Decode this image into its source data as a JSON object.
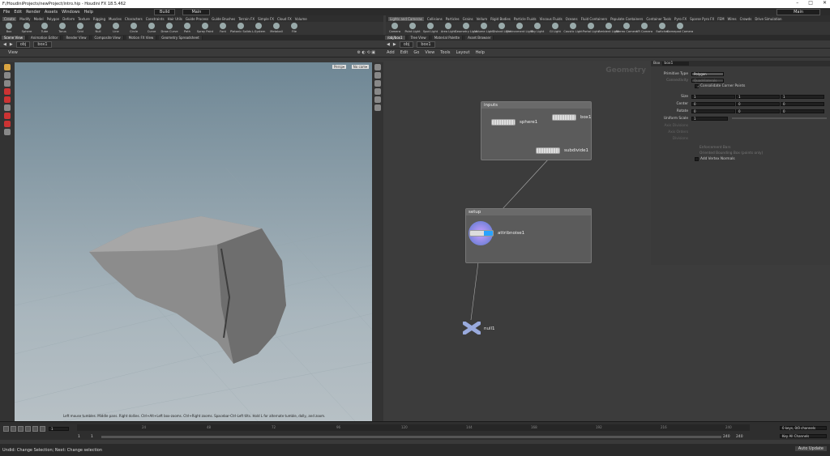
{
  "window": {
    "title": "F:/HoudiniProjects/newProject/intro.hip - Houdini FX 18.5.462",
    "controls": [
      "–",
      "□",
      "✕"
    ]
  },
  "menubar": {
    "items": [
      "File",
      "Edit",
      "Render",
      "Assets",
      "Windows",
      "Help"
    ],
    "desktop": "Build",
    "desktop2": "Main",
    "right_desktop": "Main"
  },
  "shelf_left": {
    "tabs": [
      "Create",
      "Modify",
      "Model",
      "Polygon",
      "Deform",
      "Texture",
      "Rigging",
      "Muscles",
      "Characters",
      "Constraints",
      "Hair Utils",
      "Guide Process",
      "Guide Brushes",
      "Terrain FX",
      "Simple FX",
      "Cloud FX",
      "Volume"
    ],
    "active_tab": "Create",
    "tools": [
      "Box",
      "Sphere",
      "Tube",
      "Torus",
      "Grid",
      "Null",
      "Line",
      "Circle",
      "Curve",
      "Draw Curve",
      "Path",
      "Spray Paint",
      "Font",
      "Platonic Solids",
      "L-System",
      "Metaball",
      "File"
    ]
  },
  "shelf_right": {
    "tabs": [
      "Lights and Cameras",
      "Collisions",
      "Particles",
      "Grains",
      "Vellum",
      "Rigid Bodies",
      "Particle Fluids",
      "Viscous Fluids",
      "Oceans",
      "Fluid Containers",
      "Populate Containers",
      "Container Tools",
      "Pyro FX",
      "Sparse Pyro FX",
      "FEM",
      "Wires",
      "Crowds",
      "Drive Simulation"
    ],
    "active_tab": "Lights and Cameras",
    "tools": [
      "Camera",
      "Point Light",
      "Spot Light",
      "Area Light",
      "Geometry Light",
      "Volume Light",
      "Distant Light",
      "Environment Light",
      "Sky Light",
      "GI Light",
      "Caustic Light",
      "Portal Light",
      "Ambient Light",
      "Stereo Camera",
      "VR Camera",
      "Switcher",
      "Gamepad Camera"
    ]
  },
  "left_panel": {
    "tabs": [
      "Scene View",
      "Animation Editor",
      "Render View",
      "Composite View",
      "Motion FX View",
      "Geometry Spreadsheet"
    ],
    "active_tab": "Scene View",
    "path": [
      "obj",
      "box1"
    ],
    "view_label": "View",
    "persp": "Persp▾",
    "nocam": "No cam▾",
    "hint": "Left mouse tumbles. Middle pans. Right dollies. Ctrl+Alt+Left box-zooms. Ctrl+Right zooms. Spacebar-Ctrl-Left tilts. Hold L for alternate tumble, dolly, and zoom."
  },
  "right_panel": {
    "tabs": [
      "/obj/box1",
      "Tree View",
      "Material Palette",
      "Asset Browser"
    ],
    "active_tab": "/obj/box1",
    "path": [
      "obj",
      "box1"
    ],
    "menu": [
      "Add",
      "Edit",
      "Go",
      "View",
      "Tools",
      "Layout",
      "Help"
    ],
    "context_label": "Geometry"
  },
  "network": {
    "boxes": [
      {
        "title": "inputs"
      },
      {
        "title": "setup"
      }
    ],
    "nodes": [
      "sphere1",
      "box1",
      "subdivide1",
      "attribnoise1",
      "null1"
    ]
  },
  "parms": {
    "node_type": "Box",
    "node_name": "box1",
    "primitive_type_label": "Primitive Type",
    "primitive_type": "Polygon",
    "connectivity_label": "Connectivity",
    "connectivity": "Quadrilaterals",
    "consolidate": "Consolidate Corner Points",
    "rows": [
      {
        "label": "Size",
        "values": [
          "1",
          "1",
          "1"
        ]
      },
      {
        "label": "Center",
        "values": [
          "0",
          "0",
          "0"
        ]
      },
      {
        "label": "Rotate",
        "values": [
          "0",
          "0",
          "0"
        ]
      }
    ],
    "uniform_label": "Uniform Scale",
    "uniform_value": "1",
    "disabled_rows": [
      "Axis Divisions",
      "Axis Orders",
      "Divisions"
    ],
    "bbox1": "Enforcement Bars",
    "bbox2": "Oriented Bounding Box (points only)",
    "bbox3": "Add Vertex Normals"
  },
  "timeline": {
    "frame": "1",
    "start": "1",
    "start2": "1",
    "end": "240",
    "end2": "240",
    "ticks": [
      "24",
      "48",
      "72",
      "96",
      "120",
      "144",
      "168",
      "192",
      "216",
      "240"
    ],
    "keys_label": "0 keys, 0/0 channels",
    "channels_label": "Key All Channels",
    "auto_update": "Auto Update"
  },
  "status": {
    "text": "Undid: Change Selection; Next: Change selection"
  }
}
